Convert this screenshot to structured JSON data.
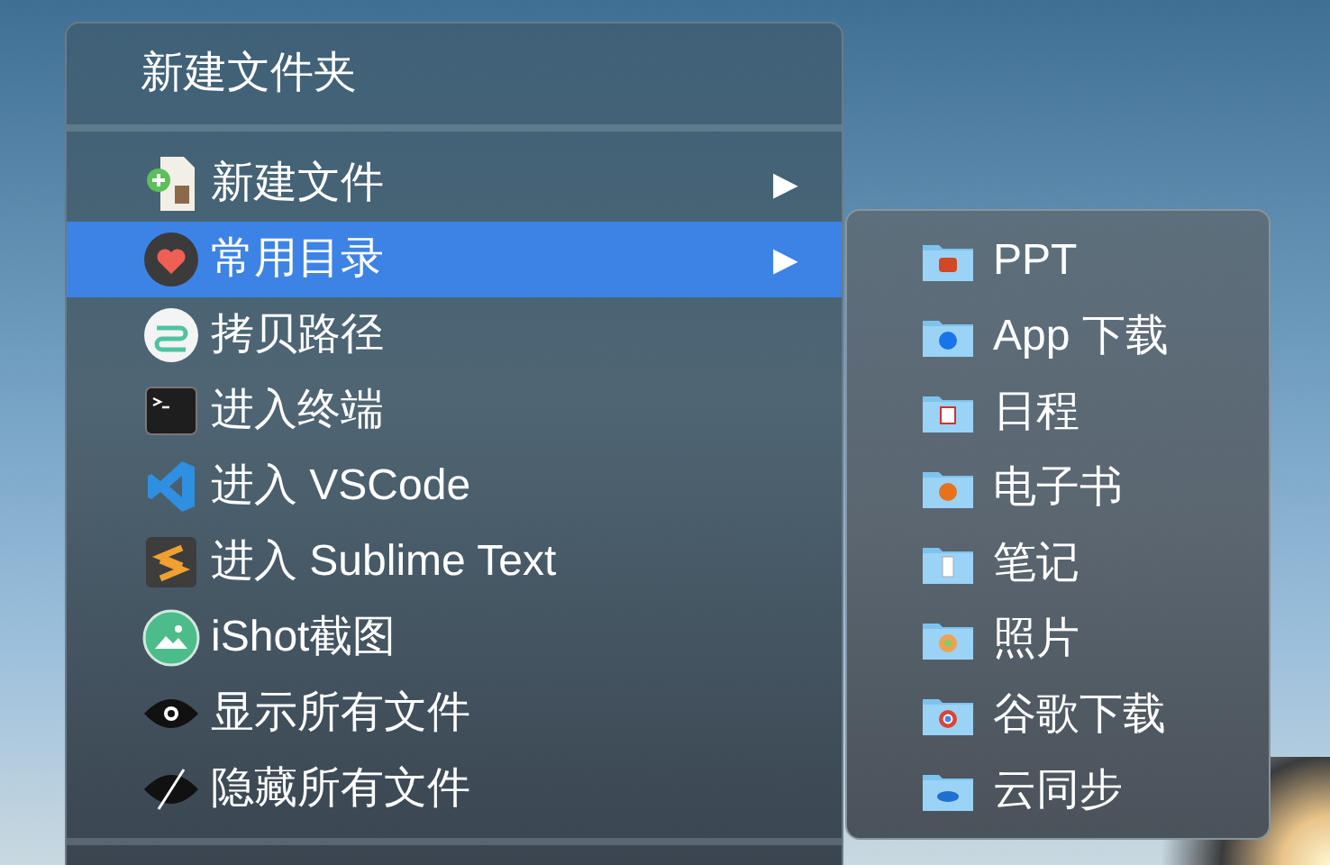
{
  "menu": {
    "header": "新建文件夹",
    "items": [
      {
        "label": "新建文件",
        "selected": false,
        "arrow": "▶"
      },
      {
        "label": "常用目录",
        "selected": true,
        "arrow": "▶"
      },
      {
        "label": "拷贝路径",
        "selected": false
      },
      {
        "label": "进入终端",
        "selected": false
      },
      {
        "label": "进入 VSCode",
        "selected": false
      },
      {
        "label": "进入 Sublime Text",
        "selected": false
      },
      {
        "label": "iShot截图",
        "selected": false
      },
      {
        "label": "显示所有文件",
        "selected": false
      },
      {
        "label": "隐藏所有文件",
        "selected": false
      }
    ]
  },
  "submenu": {
    "items": [
      {
        "label": "PPT"
      },
      {
        "label": "App 下载"
      },
      {
        "label": "日程"
      },
      {
        "label": "电子书"
      },
      {
        "label": "笔记"
      },
      {
        "label": "照片"
      },
      {
        "label": "谷歌下载"
      },
      {
        "label": "云同步"
      }
    ]
  }
}
